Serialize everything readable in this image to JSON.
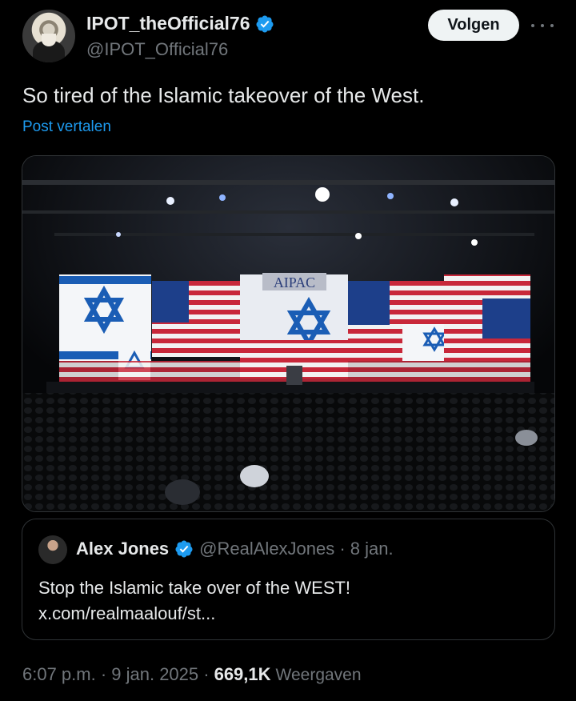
{
  "author": {
    "display_name": "IPOT_theOfficial76",
    "handle": "@IPOT_Official76",
    "verified_icon": "verified-badge-icon",
    "avatar_icon": "profile-portrait"
  },
  "actions": {
    "follow_label": "Volgen",
    "more_icon": "more-options-icon"
  },
  "tweet": {
    "text": "So tired of the Islamic takeover of the West.",
    "translate_label": "Post vertalen"
  },
  "media": {
    "description_icon": "conference-stage-photo",
    "stage_sign": "AIPAC"
  },
  "quote": {
    "display_name": "Alex Jones",
    "handle_date": "@RealAlexJones · 8 jan.",
    "text_line1": "Stop the Islamic take over of the WEST!",
    "text_line2": "x.com/realmaalouf/st..."
  },
  "meta": {
    "time_date": "6:07 p.m. · 9 jan. 2025 ·",
    "views_count": "669,1K",
    "views_label": "Weergaven"
  },
  "colors": {
    "background": "#000000",
    "accent": "#1d9bf0",
    "text_primary": "#e7e9ea",
    "text_secondary": "#71767b",
    "border": "#2f3336"
  }
}
